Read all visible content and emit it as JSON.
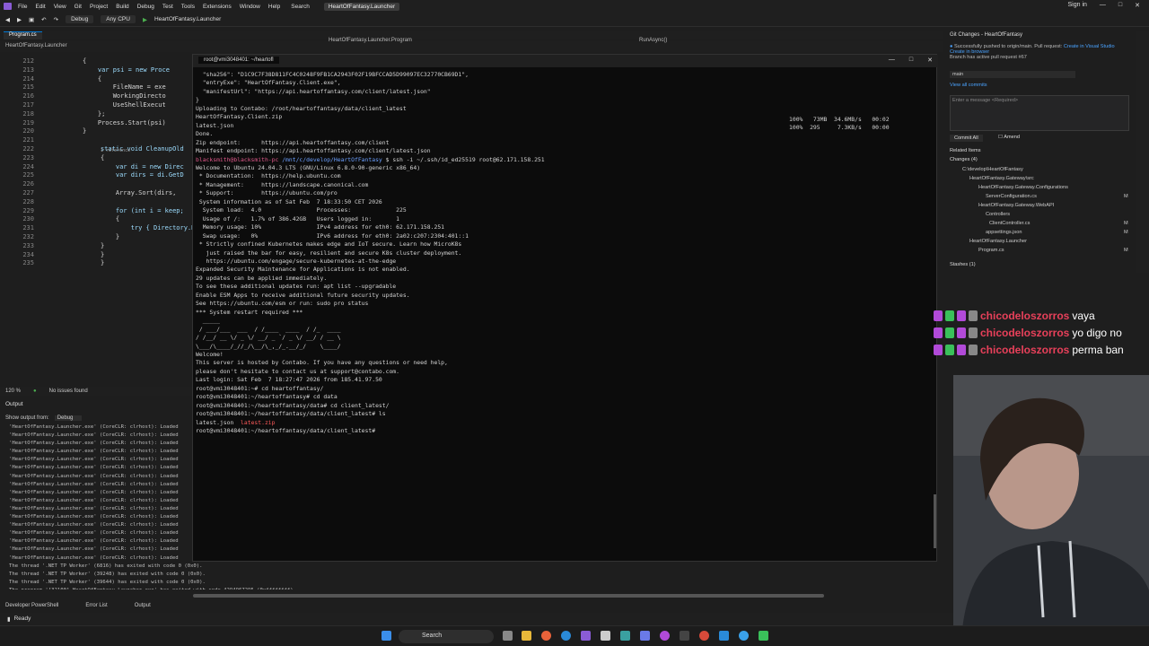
{
  "titlebar": {
    "menus": [
      "File",
      "Edit",
      "View",
      "Git",
      "Project",
      "Build",
      "Debug",
      "Test",
      "Tools",
      "Extensions",
      "Window",
      "Help"
    ],
    "search": "Search",
    "project": "HeartOfFantasy.Launcher",
    "signin": "Sign in"
  },
  "toolbar": {
    "config": "Debug",
    "platform": "Any CPU",
    "run_target": "HeartOfFantasy.Launcher"
  },
  "editor": {
    "tab": "Program.cs",
    "breadcrumb_left": "HeartOfFantasy.Launcher",
    "breadcrumb_mid": "HeartOfFantasy.Launcher.Program",
    "breadcrumb_right": "RunAsync()",
    "lines": [
      {
        "n": "212",
        "t": "{"
      },
      {
        "n": "213",
        "t": "    var psi = new Proce"
      },
      {
        "n": "214",
        "t": "    {"
      },
      {
        "n": "215",
        "t": "        FileName = exe"
      },
      {
        "n": "216",
        "t": "        WorkingDirecto"
      },
      {
        "n": "217",
        "t": "        UseShellExecut"
      },
      {
        "n": "218",
        "t": "    };"
      },
      {
        "n": "219",
        "t": "    Process.Start(psi)"
      },
      {
        "n": "220",
        "t": "}"
      },
      {
        "n": "221",
        "t": ""
      },
      {
        "n": "222",
        "t": "static void CleanupOld"
      },
      {
        "n": "223",
        "t": "{"
      },
      {
        "n": "224",
        "t": "    var di = new Direc"
      },
      {
        "n": "225",
        "t": "    var dirs = di.GetD"
      },
      {
        "n": "226",
        "t": ""
      },
      {
        "n": "227",
        "t": "    Array.Sort(dirs,"
      },
      {
        "n": "228",
        "t": ""
      },
      {
        "n": "229",
        "t": "    for (int i = keep;"
      },
      {
        "n": "230",
        "t": "    {"
      },
      {
        "n": "231",
        "t": "        try { Directory.Delete(dirs[i]."
      },
      {
        "n": "232",
        "t": "    }"
      },
      {
        "n": "233",
        "t": "}"
      },
      {
        "n": "234",
        "t": "}"
      },
      {
        "n": "235",
        "t": "}"
      }
    ],
    "ref_label": "1 reference",
    "zoom": "120 %",
    "issues": "No issues found"
  },
  "output": {
    "title": "Output",
    "show_from_label": "Show output from:",
    "show_from_value": "Debug",
    "lines": [
      "'HeartOfFantasy.Launcher.exe' (CoreCLR: clrhost): Loaded",
      "'HeartOfFantasy.Launcher.exe' (CoreCLR: clrhost): Loaded",
      "'HeartOfFantasy.Launcher.exe' (CoreCLR: clrhost): Loaded",
      "'HeartOfFantasy.Launcher.exe' (CoreCLR: clrhost): Loaded",
      "'HeartOfFantasy.Launcher.exe' (CoreCLR: clrhost): Loaded",
      "'HeartOfFantasy.Launcher.exe' (CoreCLR: clrhost): Loaded",
      "'HeartOfFantasy.Launcher.exe' (CoreCLR: clrhost): Loaded",
      "'HeartOfFantasy.Launcher.exe' (CoreCLR: clrhost): Loaded",
      "'HeartOfFantasy.Launcher.exe' (CoreCLR: clrhost): Loaded",
      "'HeartOfFantasy.Launcher.exe' (CoreCLR: clrhost): Loaded",
      "'HeartOfFantasy.Launcher.exe' (CoreCLR: clrhost): Loaded",
      "'HeartOfFantasy.Launcher.exe' (CoreCLR: clrhost): Loaded",
      "'HeartOfFantasy.Launcher.exe' (CoreCLR: clrhost): Loaded",
      "'HeartOfFantasy.Launcher.exe' (CoreCLR: clrhost): Loaded",
      "'HeartOfFantasy.Launcher.exe' (CoreCLR: clrhost): Loaded",
      "'HeartOfFantasy.Launcher.exe' (CoreCLR: clrhost): Loaded",
      "'HeartOfFantasy.Launcher.exe' (CoreCLR: clrhost): Loaded",
      "The thread '.NET TP Worker' (6816) has exited with code 0 (0x0).",
      "The thread '.NET TP Worker' (39248) has exited with code 0 (0x0).",
      "The thread '.NET TP Worker' (39644) has exited with code 0 (0x0).",
      "The program '[32100] HeartOfFantasy.Launcher.exe' has exited with code 4294967295 (0xffffffff)."
    ],
    "bottom_tabs": [
      "Developer PowerShell",
      "Error List",
      "Output"
    ],
    "status": "Ready"
  },
  "terminal": {
    "tab_title": "root@vmi3048401: ~/heartofl",
    "right_block": [
      "100%   73MB  34.6MB/s   00:02",
      "100%  295     7.3KB/s   00:00"
    ],
    "lines": [
      {
        "t": "  \"sha256\": \"D1C9C7F38D811FC4C0248F9FB1CA2943F02F19BFCCAD5D99097EC32770CB69D1\","
      },
      {
        "t": "  \"entryExe\": \"HeartOfFantasy.Client.exe\","
      },
      {
        "t": "  \"manifestUrl\": \"https://api.heartoffantasy.com/client/latest.json\""
      },
      {
        "t": "}"
      },
      {
        "t": "Uploading to Contabo: /root/heartoffantasy/data/client_latest"
      },
      {
        "t": "HeartOfFantasy.Client.zip"
      },
      {
        "t": "latest.json"
      },
      {
        "t": "Done."
      },
      {
        "t": "Zip endpoint:      https://api.heartoffantasy.com/client"
      },
      {
        "t": "Manifest endpoint: https://api.heartoffantasy.com/client/latest.json"
      },
      {
        "pre": "blacksmith@blacksmith-pc",
        "mid": " /mnt/c/develop/HeartOfFantasy",
        "t": " $ ssh -i ~/.ssh/id_ed25519 root@62.171.158.251"
      },
      {
        "t": "Welcome to Ubuntu 24.04.3 LTS (GNU/Linux 6.8.0-90-generic x86_64)"
      },
      {
        "t": ""
      },
      {
        "t": " * Documentation:  https://help.ubuntu.com"
      },
      {
        "t": " * Management:     https://landscape.canonical.com"
      },
      {
        "t": " * Support:        https://ubuntu.com/pro"
      },
      {
        "t": ""
      },
      {
        "t": " System information as of Sat Feb  7 18:33:50 CET 2026"
      },
      {
        "t": ""
      },
      {
        "t": "  System load:  4.0                Processes:             225"
      },
      {
        "t": "  Usage of /:   1.7% of 386.42GB   Users logged in:       1"
      },
      {
        "t": "  Memory usage: 10%                IPv4 address for eth0: 62.171.158.251"
      },
      {
        "t": "  Swap usage:   0%                 IPv6 address for eth0: 2a02:c207:2304:401::1"
      },
      {
        "t": ""
      },
      {
        "t": " * Strictly confined Kubernetes makes edge and IoT secure. Learn how MicroK8s"
      },
      {
        "t": "   just raised the bar for easy, resilient and secure K8s cluster deployment."
      },
      {
        "t": ""
      },
      {
        "t": "   https://ubuntu.com/engage/secure-kubernetes-at-the-edge"
      },
      {
        "t": ""
      },
      {
        "t": "Expanded Security Maintenance for Applications is not enabled."
      },
      {
        "t": ""
      },
      {
        "t": "29 updates can be applied immediately."
      },
      {
        "t": "To see these additional updates run: apt list --upgradable"
      },
      {
        "t": ""
      },
      {
        "t": "Enable ESM Apps to receive additional future security updates."
      },
      {
        "t": "See https://ubuntu.com/esm or run: sudo pro status"
      },
      {
        "t": ""
      },
      {
        "t": ""
      },
      {
        "t": "*** System restart required ***"
      },
      {
        "t": "  _____"
      },
      {
        "t": " / ___/___  ___  / /____  ____  / /_  ____"
      },
      {
        "t": "/ /__/ __ \\/ _ \\/ __/ _ `/ _ \\/ __/ / __ \\"
      },
      {
        "t": "\\___/\\____/_//_/\\__/\\_,_/_.__/_/    \\____/"
      },
      {
        "t": ""
      },
      {
        "t": "Welcome!"
      },
      {
        "t": ""
      },
      {
        "t": "This server is hosted by Contabo. If you have any questions or need help,"
      },
      {
        "t": "please don't hesitate to contact us at support@contabo.com."
      },
      {
        "t": ""
      },
      {
        "t": "Last login: Sat Feb  7 18:27:47 2026 from 185.41.97.50"
      },
      {
        "t": "root@vmi3048401:~# cd heartoffantasy/"
      },
      {
        "t": "root@vmi3048401:~/heartoffantasy# cd data"
      },
      {
        "t": "root@vmi3048401:~/heartoffantasy/data# cd client_latest/"
      },
      {
        "t": "root@vmi3048401:~/heartoffantasy/data/client_latest# ls"
      },
      {
        "t": "latest.json  ",
        "red": "latest.zip"
      },
      {
        "t": "root@vmi3048401:~/heartoffantasy/data/client_latest# "
      }
    ]
  },
  "git": {
    "title": "Git Changes - HeartOfFantasy",
    "note": "Successfully pushed to origin/main. Pull request:",
    "note_link1": "Create in Visual Studio",
    "note_link2": "Create in browser",
    "note2": "Branch has active pull request #67",
    "branch": "main",
    "commits": "View all commits",
    "message_placeholder": "Enter a message <Required>",
    "commit_all": "Commit All",
    "amend": "Amend",
    "related": "Related Items",
    "changes": "Changes (4)",
    "tree": [
      "C:\\develop\\HeartOfFantasy",
      "HeartOfFantasy.Gateway\\src",
      "HeartOfFantasy.Gateway.Configurations",
      "ServerConfiguration.cs",
      "HeartOfFantasy.Gateway.WebAPI",
      "Controllers",
      "ClientController.cs",
      "appsettings.json",
      "HeartOfFantasy.Launcher",
      "Program.cs"
    ],
    "stashes": "Stashes (1)"
  },
  "chat": [
    {
      "user": "chicodeloszorros",
      "text": "vaya"
    },
    {
      "user": "chicodeloszorros",
      "text": "yo digo no"
    },
    {
      "user": "chicodeloszorros",
      "text": "perma ban"
    }
  ],
  "taskbar": {
    "search": "Search"
  }
}
